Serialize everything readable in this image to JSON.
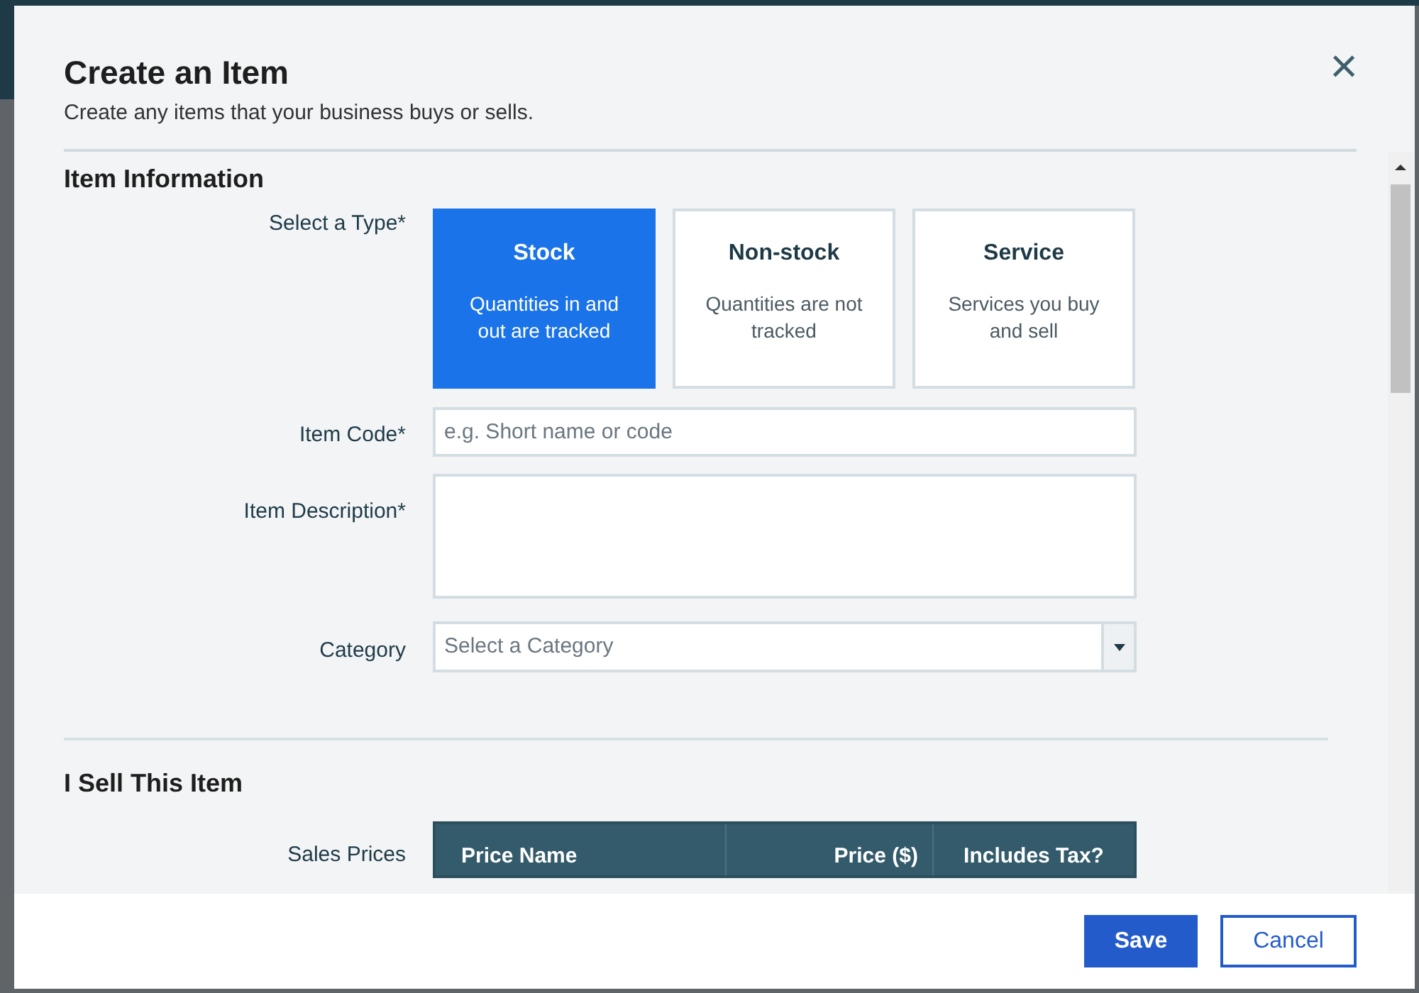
{
  "dialog": {
    "title": "Create an Item",
    "subtitle": "Create any items that your business buys or sells.",
    "close_icon": "×"
  },
  "item_information": {
    "heading": "Item Information",
    "type_label": "Select a Type*",
    "types": [
      {
        "title": "Stock",
        "description": "Quantities in and out are tracked",
        "selected": true
      },
      {
        "title": "Non-stock",
        "description": "Quantities are not tracked",
        "selected": false
      },
      {
        "title": "Service",
        "description": "Services you buy and sell",
        "selected": false
      }
    ],
    "item_code": {
      "label": "Item Code*",
      "placeholder": "e.g. Short name or code"
    },
    "item_description": {
      "label": "Item Description*"
    },
    "category": {
      "label": "Category",
      "placeholder": "Select a Category"
    }
  },
  "sell_section": {
    "heading": "I Sell This Item",
    "sales_prices_label": "Sales Prices",
    "table": {
      "columns": [
        "Price Name",
        "Price ($)",
        "Includes Tax?"
      ]
    }
  },
  "buttons": [
    {
      "label": "Save",
      "kind": "primary"
    },
    {
      "label": "Cancel",
      "kind": "secondary"
    }
  ]
}
